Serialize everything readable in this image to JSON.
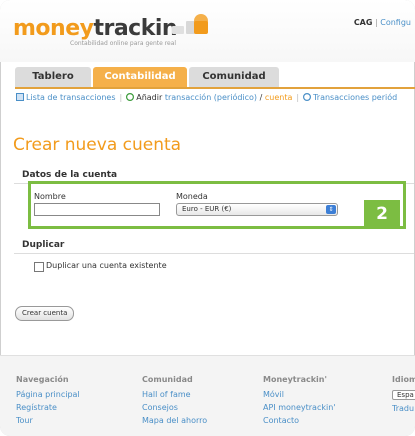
{
  "header": {
    "logo_money": "money",
    "logo_trackin": "trackin",
    "tagline": "Contabilidad online para gente real",
    "user": "CAG",
    "separator": "|",
    "config_link": "Configu"
  },
  "tabs": [
    {
      "label": "Tablero"
    },
    {
      "label": "Contabilidad"
    },
    {
      "label": "Comunidad"
    }
  ],
  "subnav": {
    "transactions": "Lista de transacciones",
    "add_prefix": "Añadir",
    "add_link": "transacción (periódico)",
    "slash": "/",
    "add_account": "cuenta",
    "periodic": "Transacciones periód"
  },
  "page": {
    "title": "Crear nueva cuenta"
  },
  "account_data": {
    "legend": "Datos de la cuenta",
    "name_label": "Nombre",
    "name_value": "",
    "currency_label": "Moneda",
    "currency_value": "Euro - EUR (€)",
    "badge": "2"
  },
  "duplicate": {
    "legend": "Duplicar",
    "checkbox_label": "Duplicar una cuenta existente"
  },
  "create_button": "Crear cuenta",
  "footer": {
    "col1": {
      "heading": "Navegación",
      "links": [
        "Página principal",
        "Regístrate",
        "Tour"
      ]
    },
    "col2": {
      "heading": "Comunidad",
      "links": [
        "Hall of fame",
        "Consejos",
        "Mapa del ahorro"
      ]
    },
    "col3": {
      "heading": "Moneytrackin'",
      "links": [
        "Móvil",
        "API moneytrackin'",
        "Contacto"
      ]
    },
    "col4": {
      "heading": "Idiom",
      "button": "Espa",
      "link": "Tradu"
    }
  },
  "colors": {
    "accent_orange": "#f29b1c",
    "link_blue": "#4a8fc7",
    "highlight_green": "#7cbd42"
  }
}
